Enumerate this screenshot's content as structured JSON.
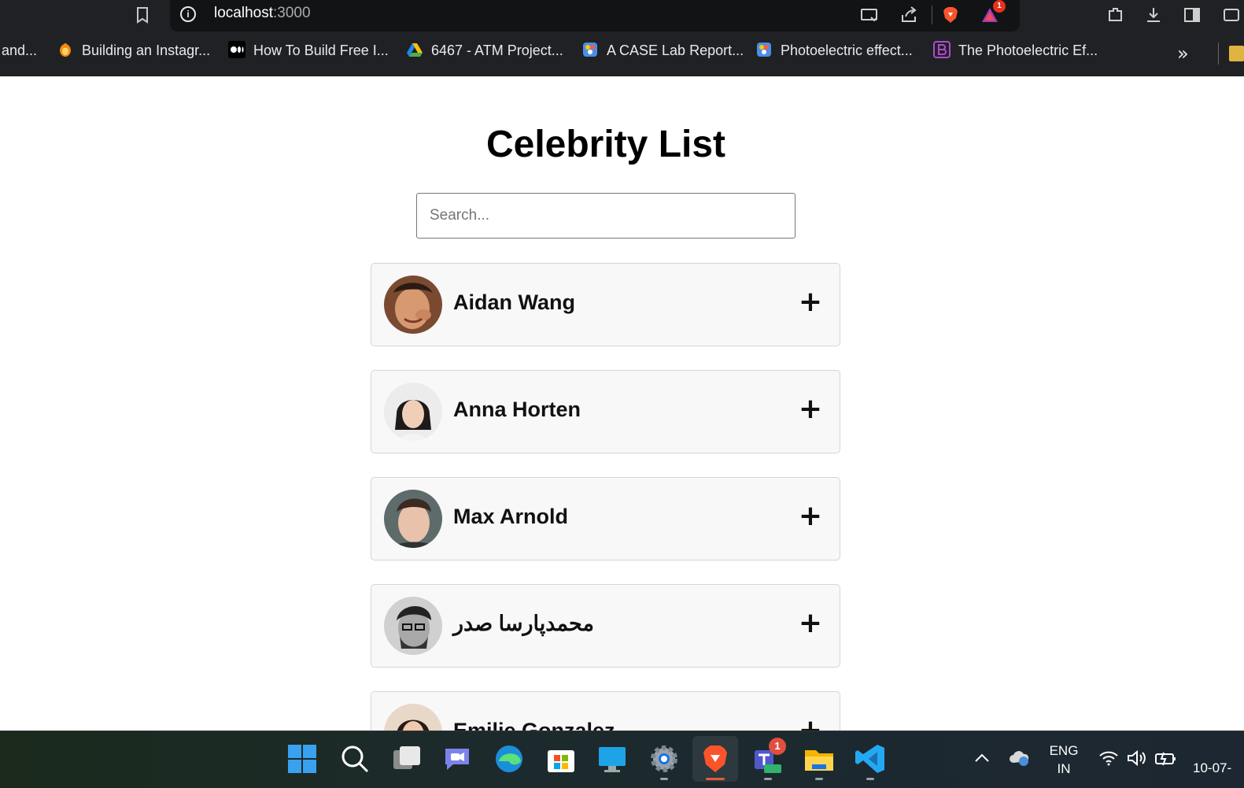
{
  "browser": {
    "url_host": "localhost",
    "url_port": ":3000",
    "brave_rewards_badge": "1",
    "bookmarks": [
      {
        "label": "and...",
        "icon": "none"
      },
      {
        "label": "Building an Instagr...",
        "icon": "penguin-icon"
      },
      {
        "label": "How To Build Free I...",
        "icon": "medium-icon"
      },
      {
        "label": "6467 - ATM Project...",
        "icon": "google-drive-icon"
      },
      {
        "label": "A CASE Lab Report...",
        "icon": "brainly-icon"
      },
      {
        "label": "Photoelectric effect...",
        "icon": "brainly-icon"
      },
      {
        "label": "The Photoelectric Ef...",
        "icon": "b-icon"
      }
    ],
    "overflow_label": "»"
  },
  "page": {
    "title": "Celebrity List",
    "search_placeholder": "Search...",
    "search_value": "",
    "expand_label": "+",
    "celebrities": [
      {
        "name": "Aidan Wang"
      },
      {
        "name": "Anna Horten"
      },
      {
        "name": "Max Arnold"
      },
      {
        "name": "محمدپارسا صدر"
      },
      {
        "name": "Emilie Gonzalez"
      }
    ]
  },
  "taskbar": {
    "apps": [
      "start-icon",
      "search-icon",
      "task-view-icon",
      "chat-icon",
      "edge-icon",
      "store-icon",
      "remote-desktop-icon",
      "settings-icon",
      "brave-icon",
      "teams-icon",
      "file-explorer-icon",
      "vscode-icon"
    ],
    "teams_badge": "1",
    "language_line1": "ENG",
    "language_line2": "IN",
    "clock": "10-07-"
  },
  "colors": {
    "chrome_bg": "#202124",
    "card_bg": "#f8f8f8",
    "card_border": "#d5d5d5",
    "brave_orange": "#fb542b"
  }
}
